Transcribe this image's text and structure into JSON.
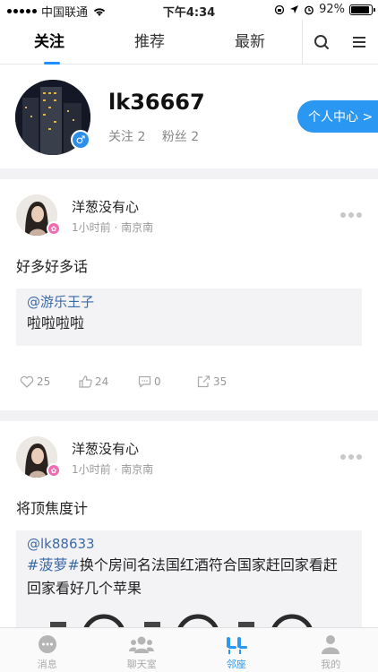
{
  "status_bar": {
    "carrier": "中国联通",
    "time": "下午4:34",
    "battery": "92%",
    "battery_level": 0.92
  },
  "top_nav": {
    "tabs": [
      {
        "label": "关注",
        "active": true
      },
      {
        "label": "推荐",
        "active": false
      },
      {
        "label": "最新",
        "active": false
      }
    ],
    "search_icon": "search-icon",
    "menu_icon": "menu-icon",
    "accent_color": "#1e90ff"
  },
  "profile": {
    "username": "lk36667",
    "following_label": "关注 2",
    "followers_label": "粉丝 2",
    "gender_icon": "male-icon",
    "personal_center_label": "个人中心 >"
  },
  "posts": [
    {
      "author": "洋葱没有心",
      "meta": "1小时前 · 南京南",
      "text": "好多好多话",
      "quote_user": "@游乐王子",
      "quote_text": "啦啦啦啦",
      "likes": "25",
      "reposts": "24",
      "comments": "0",
      "shares": "35"
    },
    {
      "author": "洋葱没有心",
      "meta": "1小时前 · 南京南",
      "text": "将顶焦度计",
      "quote_user": "@lk88633",
      "quote_hashtag": "#菠萝#",
      "quote_text": "换个房间名法国红酒符合国家赶回家看赶回家看好几个苹果"
    }
  ],
  "tab_bar": {
    "items": [
      {
        "label": "消息",
        "icon": "message-icon",
        "active": false
      },
      {
        "label": "聊天室",
        "icon": "chatroom-icon",
        "active": false
      },
      {
        "label": "邻座",
        "icon": "seat-icon",
        "active": true
      },
      {
        "label": "我的",
        "icon": "profile-icon",
        "active": false
      }
    ],
    "active_color": "#2a97f3"
  }
}
